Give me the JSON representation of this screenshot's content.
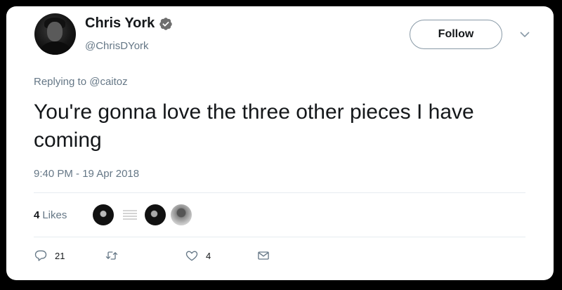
{
  "author": {
    "name": "Chris York",
    "handle": "@ChrisDYork",
    "verified_icon": "verified-badge-icon"
  },
  "follow_label": "Follow",
  "reply": {
    "prefix": "Replying to ",
    "mention": "@caitoz"
  },
  "tweet": {
    "text": "You're gonna love the three other pieces I have coming",
    "timestamp": "9:40 PM - 19 Apr 2018"
  },
  "likes": {
    "count": "4",
    "label": "Likes"
  },
  "actions": {
    "reply_count": "21",
    "retweet_count": "",
    "like_count": "4"
  },
  "colors": {
    "text": "#14171a",
    "secondary": "#657786",
    "border": "#e6ecf0",
    "background": "#000000"
  }
}
